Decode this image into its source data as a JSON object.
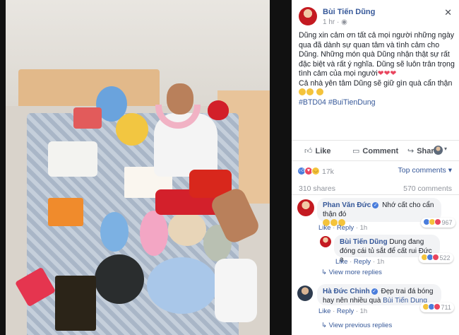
{
  "post": {
    "author": "Bùi Tiến Dũng",
    "time": "1 hr",
    "privacy_icon": "globe-icon",
    "body_line1": "Dũng xin cảm ơn tất cả mọi người những ngày qua đã dành sự quan tâm và tình cảm cho Dũng. Những món quà Dũng nhận thật sự rất đặc biệt và rất ý nghĩa. Dũng sẽ luôn trân trọng tình cảm của mọi người",
    "body_line1_hearts": "❤❤❤",
    "body_line2": "Cả nhà yên tâm Dũng sẽ giữ gìn quà cẩn thận",
    "hashtags": [
      "#BTD04",
      "#BuiTienDung"
    ]
  },
  "actions": {
    "like": "Like",
    "comment": "Comment",
    "share": "Share"
  },
  "stats": {
    "reactions": "17k",
    "top_comments": "Top comments ▾",
    "shares": "310 shares",
    "comments": "570 comments"
  },
  "comments": [
    {
      "author": "Phan Văn Đức",
      "text": "Nhớ cất cho cẩn thận đó",
      "like": "Like",
      "reply": "Reply",
      "time": "1h",
      "reaction_count": "967"
    },
    {
      "author": "Bùi Tiến Dũng",
      "text": "Dung đang đóng cái tủ sắt để cất rui Đức a",
      "like": "Like",
      "reply": "Reply",
      "time": "1h",
      "reaction_count": "522"
    },
    {
      "author": "Hà Đức Chinh",
      "text": "Đẹp trai đá bóng hay nên nhiều quà",
      "tag": "Bùi Tiến Dung",
      "like": "Like",
      "reply": "Reply",
      "time": "1h",
      "reaction_count": "711"
    }
  ],
  "view_more_replies": "View more replies",
  "view_previous_replies": "View previous replies",
  "close_symbol": "✕",
  "colors": {
    "link": "#365899",
    "like_blue": "#4a7ddc",
    "love_red": "#e9455e",
    "bubble_bg": "#f2f3f5"
  }
}
